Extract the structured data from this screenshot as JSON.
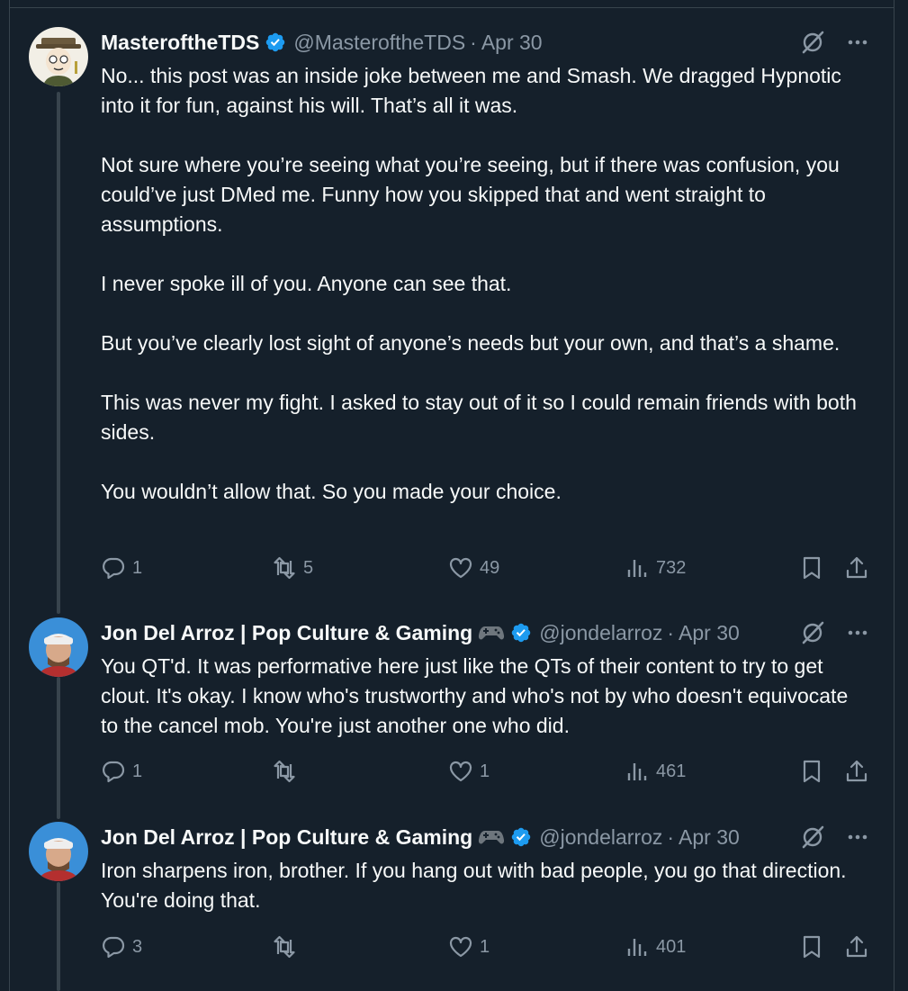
{
  "tweets": [
    {
      "name": "MasteroftheTDS",
      "handle": "@MasteroftheTDS",
      "dot": "·",
      "date": "Apr 30",
      "avatar": "cartoon-avatar-hat",
      "paragraphs": [
        "No... this post was an inside joke between me and Smash. We dragged Hypnotic into it for fun, against his will. That’s all it was.",
        "Not sure where you’re seeing what you’re seeing, but if there was confusion, you could’ve just DMed me. Funny how you skipped that and went straight to assumptions.",
        "I never spoke ill of you. Anyone can see that.",
        "But you’ve clearly lost sight of anyone’s needs but your own, and that’s a shame.",
        "This was never my fight. I asked to stay out of it so I could remain friends with both sides.",
        "You wouldn’t allow that. So you made your choice."
      ],
      "replies": "1",
      "reposts": "5",
      "likes": "49",
      "views": "732"
    },
    {
      "name": "Jon Del Arroz | Pop Culture & Gaming",
      "handle": "@jondelarroz",
      "dot": "·",
      "date": "Apr 30",
      "avatar": "photo-avatar-cap",
      "paragraphs": [
        "You QT'd. It was performative here just like the QTs of their content to try to get clout. It's okay. I know who's trustworthy and who's not by who doesn't equivocate to the cancel mob. You're just another one who did."
      ],
      "replies": "1",
      "reposts": "",
      "likes": "1",
      "views": "461"
    },
    {
      "name": "Jon Del Arroz | Pop Culture & Gaming",
      "handle": "@jondelarroz",
      "dot": "·",
      "date": "Apr 30",
      "avatar": "photo-avatar-cap",
      "paragraphs": [
        "Iron sharpens iron, brother. If you hang out with bad people, you go that direction. You're doing that."
      ],
      "replies": "3",
      "reposts": "",
      "likes": "1",
      "views": "401"
    }
  ],
  "colors": {
    "background": "#15202b",
    "text": "#f7f9f9",
    "muted": "#8b98a5",
    "verified": "#1d9bf0",
    "border": "#38444d"
  }
}
